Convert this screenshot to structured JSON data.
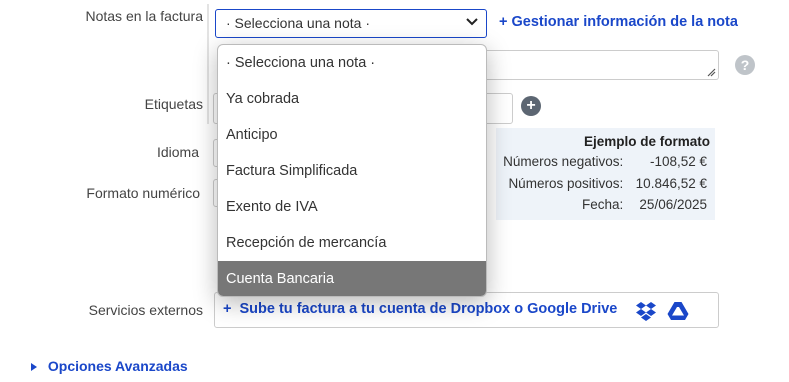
{
  "form": {
    "notes_label": "Notas en la factura",
    "notes_select_value": "· Selecciona una nota ·",
    "manage_notes_link": "Gestionar información de la nota",
    "tags_label": "Etiquetas",
    "language_label": "Idioma",
    "number_format_label": "Formato numérico",
    "external_services_label": "Servicios externos",
    "external_services_link": "Sube tu factura a tu cuenta de Dropbox o Google Drive",
    "advanced_options": "Opciones Avanzadas"
  },
  "format_example": {
    "title": "Ejemplo de formato",
    "rows": [
      {
        "label": "Números negativos:",
        "value": "-108,52 €"
      },
      {
        "label": "Números positivos:",
        "value": "10.846,52 €"
      },
      {
        "label": "Fecha:",
        "value": "25/06/2025"
      }
    ]
  },
  "dropdown": {
    "options": [
      "· Selecciona una nota ·",
      "Ya cobrada",
      "Anticipo",
      "Factura Simplificada",
      "Exento de IVA",
      "Recepción de mercancía",
      "Cuenta Bancaria"
    ],
    "highlighted_index": 6
  },
  "icons": {
    "help": "?",
    "plus": "+",
    "chevron": "chevron-down-icon",
    "dropbox": "dropbox-icon",
    "google_drive": "google-drive-icon",
    "caret": "caret-right-icon"
  },
  "colors": {
    "accent": "#1a47c9",
    "highlight": "#777777",
    "format_bg": "#eef3f9"
  }
}
